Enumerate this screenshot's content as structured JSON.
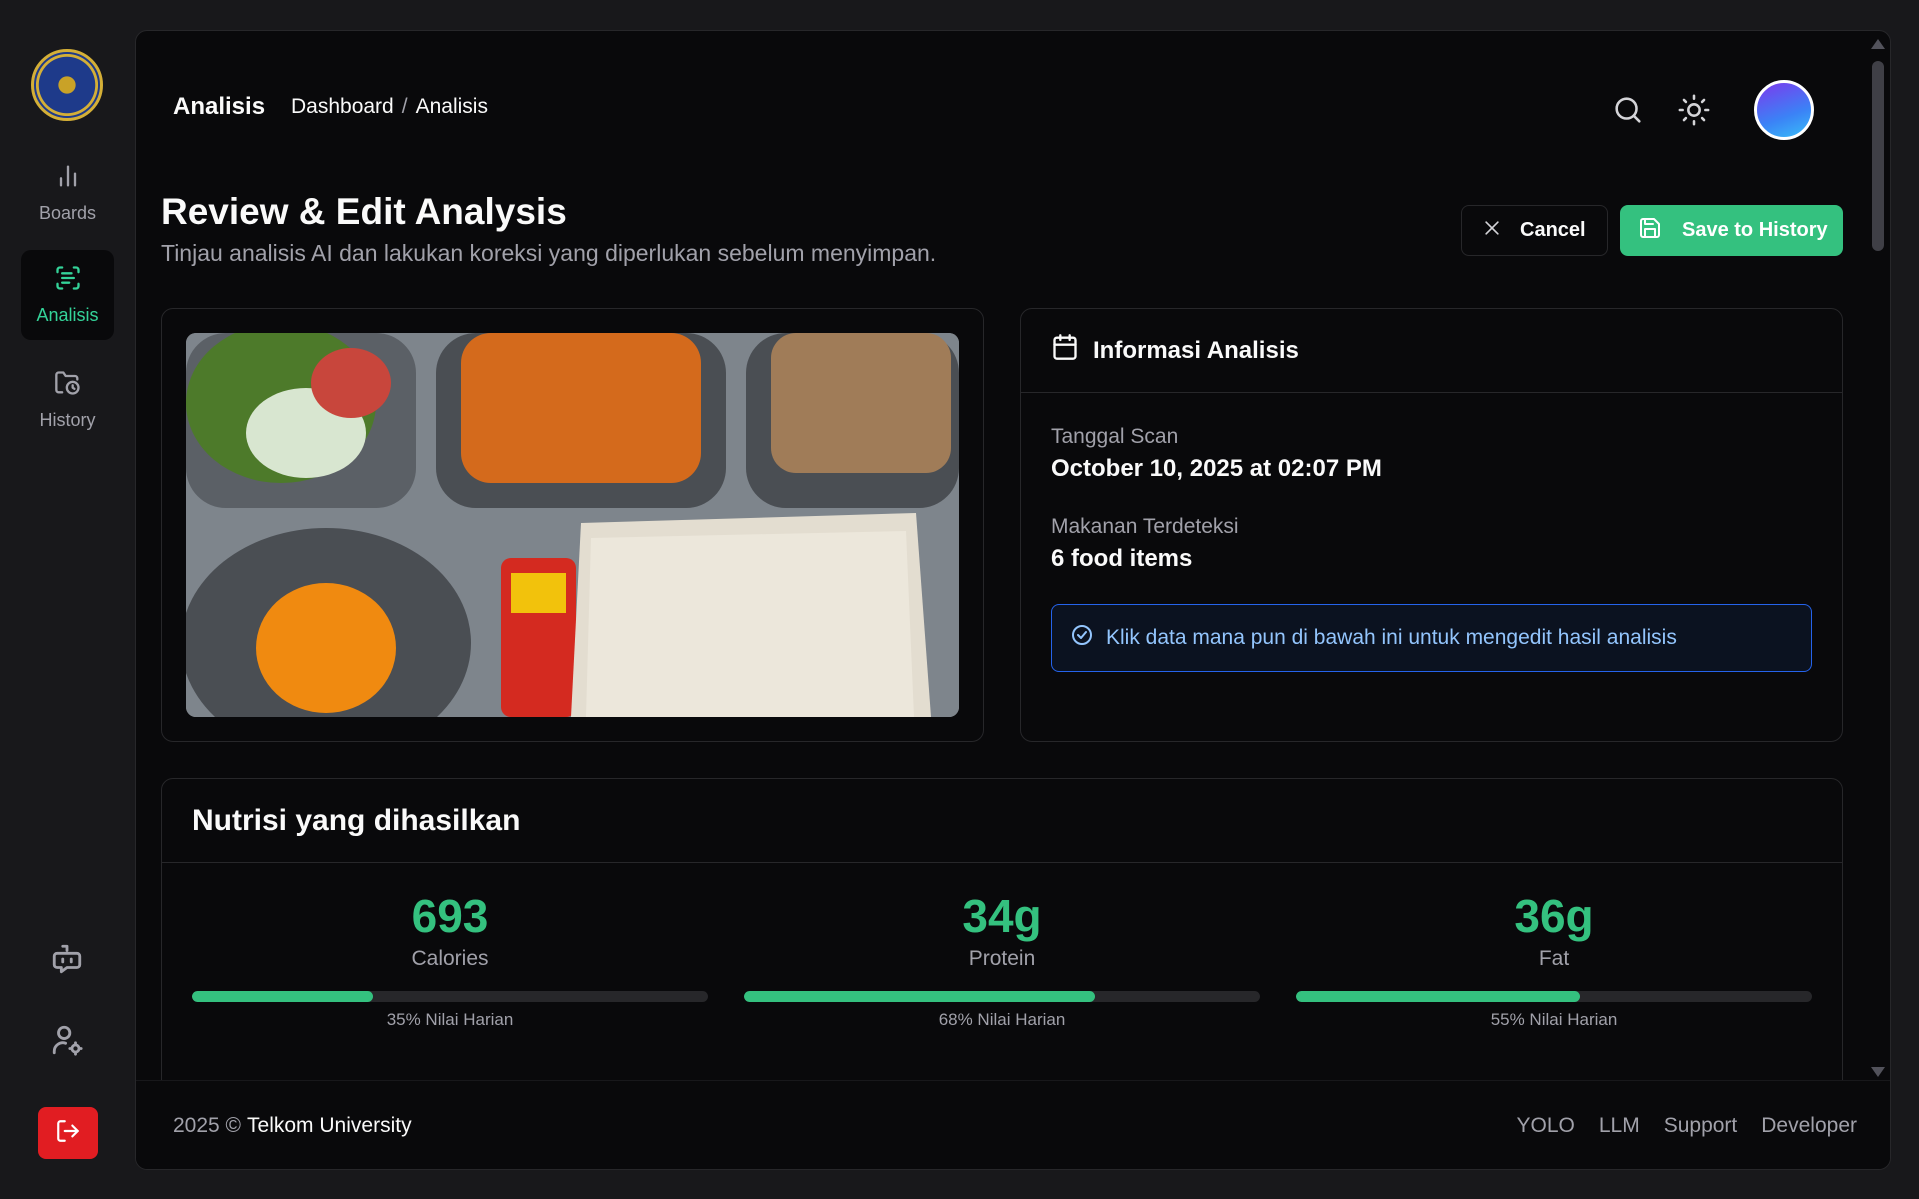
{
  "sidebar": {
    "logo": "garuda-emblem",
    "items": [
      {
        "label": "Boards",
        "icon": "bar-chart-icon",
        "active": false
      },
      {
        "label": "Analisis",
        "icon": "scan-text-icon",
        "active": true
      },
      {
        "label": "History",
        "icon": "folder-clock-icon",
        "active": false
      }
    ],
    "bottom_icons": [
      "bot-message-icon",
      "user-settings-icon",
      "logout-icon"
    ]
  },
  "header": {
    "title": "Analisis",
    "breadcrumb": [
      "Dashboard",
      "Analisis"
    ],
    "breadcrumb_separator": "/",
    "icons": [
      "search-icon",
      "sun-icon"
    ]
  },
  "page": {
    "title": "Review & Edit Analysis",
    "subtitle": "Tinjau analisis AI dan lakukan koreksi yang diperlukan sebelum menyimpan.",
    "cancel_label": "Cancel",
    "save_label": "Save to History"
  },
  "info": {
    "title": "Informasi Analisis",
    "scan_date_label": "Tanggal Scan",
    "scan_date_value": "October 10, 2025 at 02:07 PM",
    "detected_label": "Makanan Terdeteksi",
    "detected_value": "6 food items",
    "hint": "Klik data mana pun di bawah ini untuk mengedit hasil analisis"
  },
  "nutrition": {
    "title": "Nutrisi yang dihasilkan",
    "items": [
      {
        "value": "693",
        "label": "Calories",
        "percent": 35,
        "caption": "35% Nilai Harian"
      },
      {
        "value": "34g",
        "label": "Protein",
        "percent": 68,
        "caption": "68% Nilai Harian"
      },
      {
        "value": "36g",
        "label": "Fat",
        "percent": 55,
        "caption": "55% Nilai Harian"
      }
    ]
  },
  "footer": {
    "year": "2025 ©",
    "org": "Telkom University",
    "links": [
      "YOLO",
      "LLM",
      "Support",
      "Developer"
    ]
  },
  "colors": {
    "accent": "#34c17f",
    "danger": "#e11d22",
    "hint_border": "#2563eb",
    "background": "#09090b"
  }
}
